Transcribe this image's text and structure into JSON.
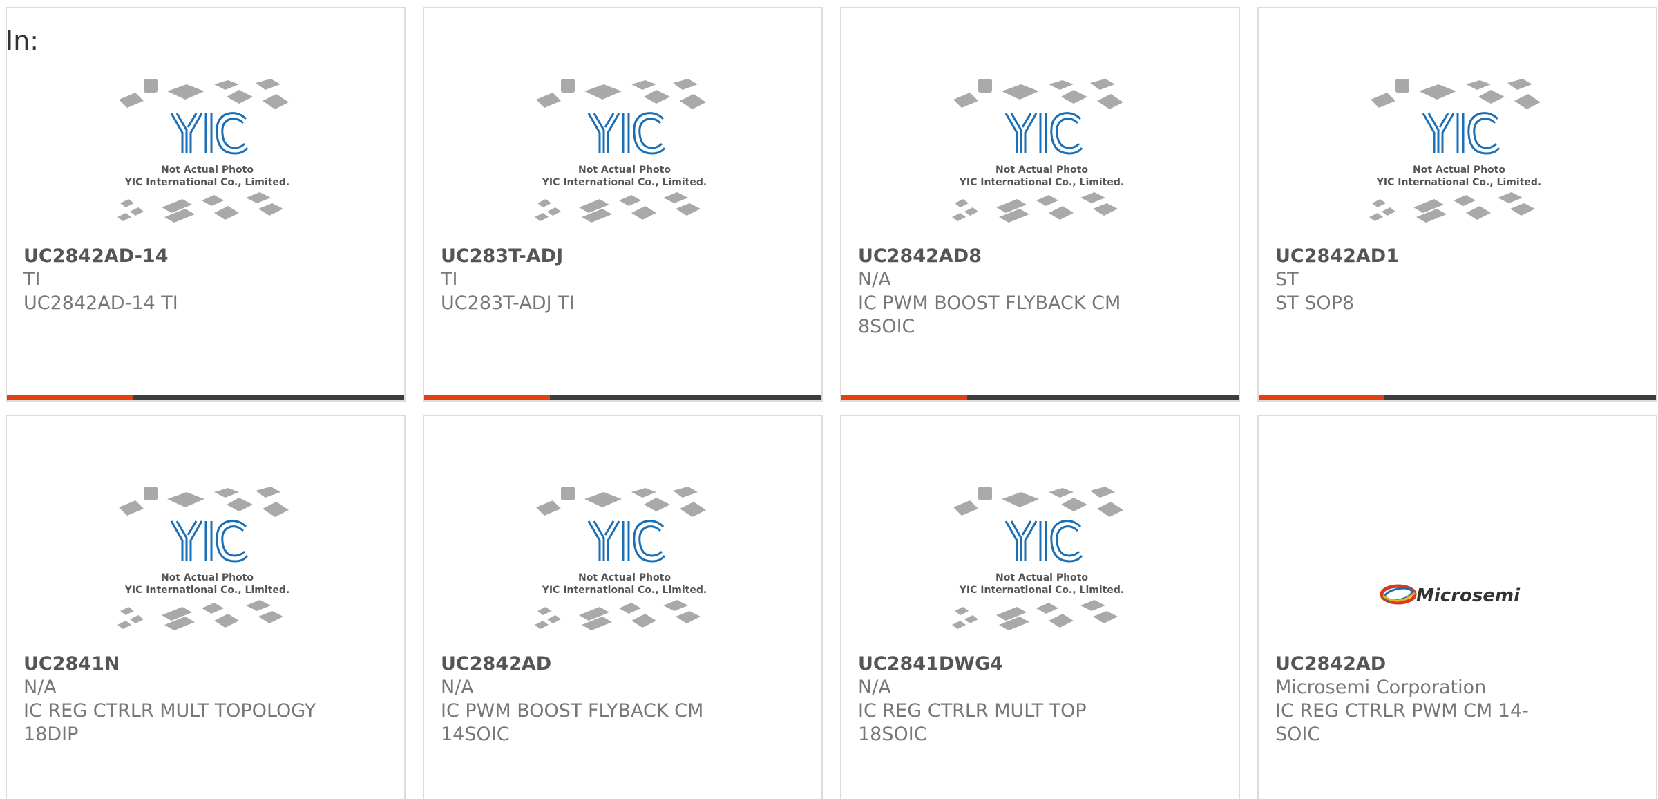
{
  "prefix_label": "In:",
  "colors": {
    "accent_bar": "#e2400f",
    "bar_rest": "#3d3d3d",
    "yic_logo_blue": "#1a6fb5",
    "chip_gray": "#a9a9a9"
  },
  "placeholder_image": {
    "line1": "Not Actual Photo",
    "line2": "YIC International Co., Limited."
  },
  "brand_logo_text": "Microsemi",
  "products": [
    {
      "part": "UC2842AD-14",
      "manufacturer": "TI",
      "description": "UC2842AD-14 TI",
      "image": "placeholder"
    },
    {
      "part": "UC283T-ADJ",
      "manufacturer": "TI",
      "description": "UC283T-ADJ TI",
      "image": "placeholder"
    },
    {
      "part": "UC2842AD8",
      "manufacturer": "N/A",
      "description": "IC PWM BOOST FLYBACK CM 8SOIC",
      "image": "placeholder"
    },
    {
      "part": "UC2842AD1",
      "manufacturer": "ST",
      "description": "ST SOP8",
      "image": "placeholder"
    },
    {
      "part": "UC2841N",
      "manufacturer": "N/A",
      "description": "IC REG CTRLR MULT TOPOLOGY 18DIP",
      "image": "placeholder"
    },
    {
      "part": "UC2842AD",
      "manufacturer": "N/A",
      "description": "IC PWM BOOST FLYBACK CM 14SOIC",
      "image": "placeholder"
    },
    {
      "part": "UC2841DWG4",
      "manufacturer": "N/A",
      "description": "IC REG CTRLR MULT TOP 18SOIC",
      "image": "placeholder"
    },
    {
      "part": "UC2842AD",
      "manufacturer": "Microsemi Corporation",
      "description": "IC REG CTRLR PWM CM 14-SOIC",
      "image": "microsemi-logo"
    }
  ]
}
